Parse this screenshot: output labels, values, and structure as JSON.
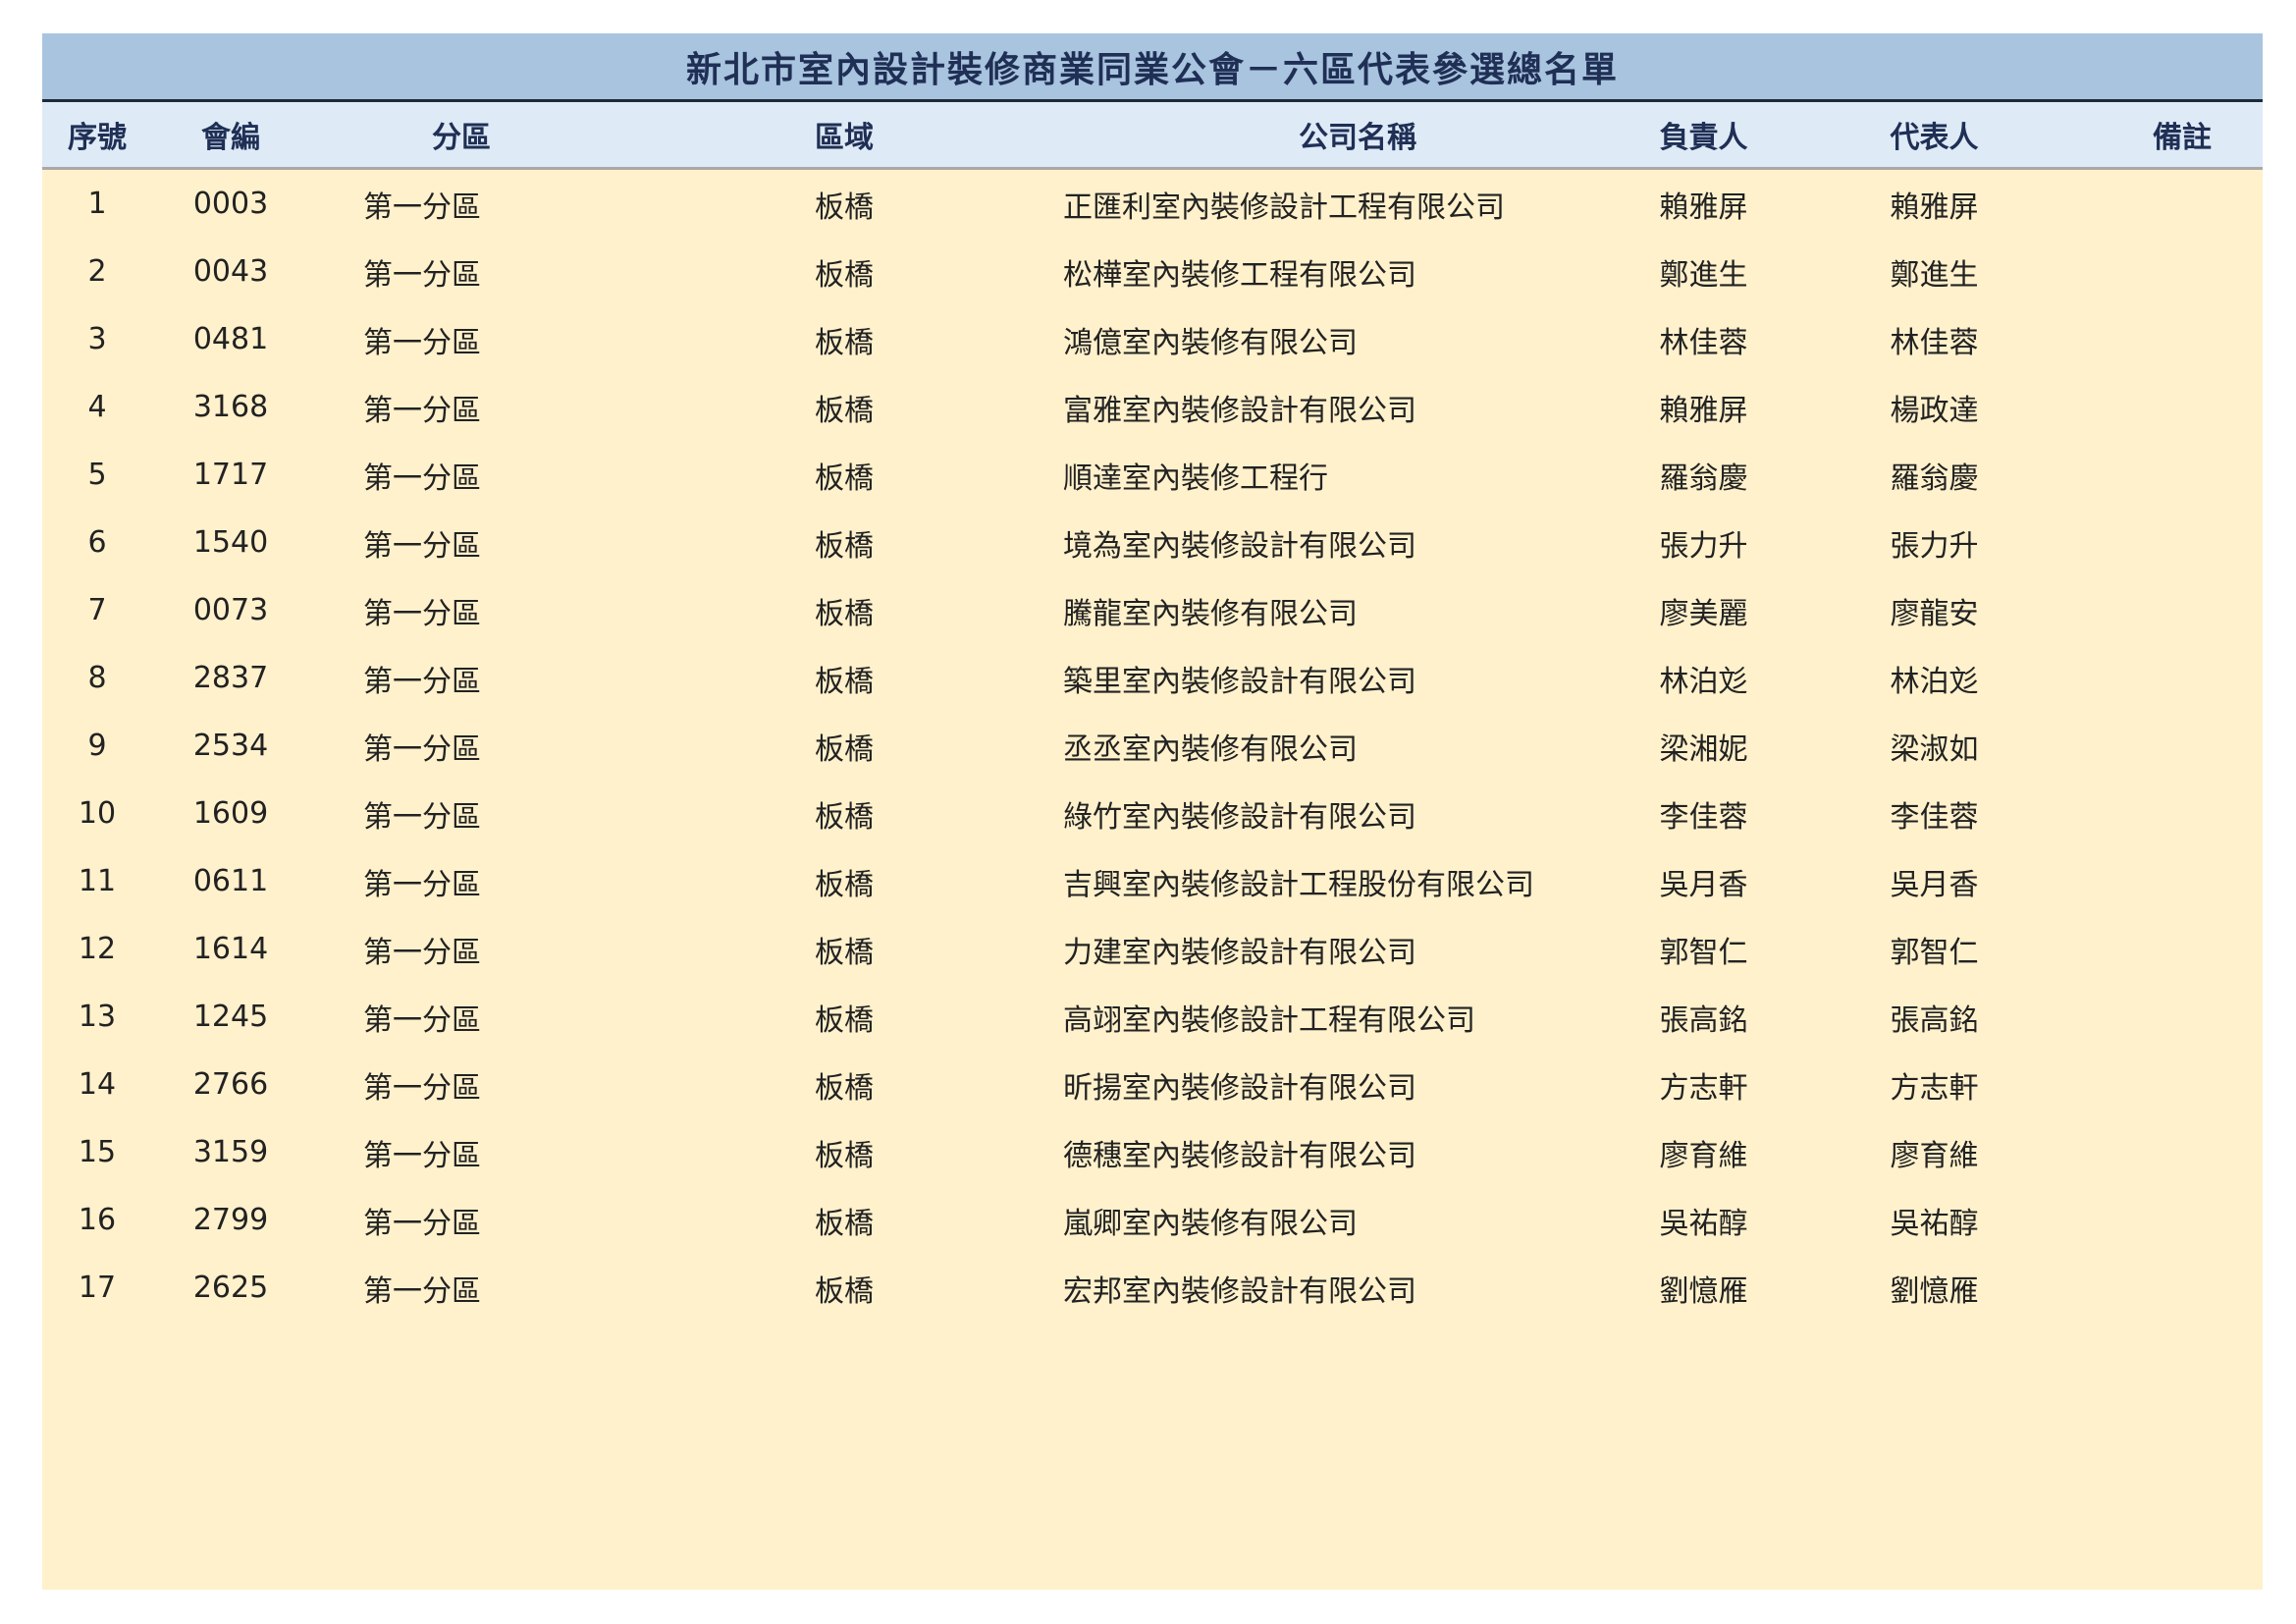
{
  "title": "新北市室內設計裝修商業同業公會－六區代表參選總名單",
  "headers": {
    "no": "序號",
    "member_code": "會編",
    "division": "分區",
    "area": "區域",
    "company": "公司名稱",
    "responsible": "負責人",
    "representative": "代表人",
    "note": "備註"
  },
  "rows": [
    {
      "no": "1",
      "code": "0003",
      "division": "第一分區",
      "area": "板橋",
      "company": "正匯利室內裝修設計工程有限公司",
      "responsible": "賴雅屏",
      "representative": "賴雅屏",
      "note": ""
    },
    {
      "no": "2",
      "code": "0043",
      "division": "第一分區",
      "area": "板橋",
      "company": "松樺室內裝修工程有限公司",
      "responsible": "鄭進生",
      "representative": "鄭進生",
      "note": ""
    },
    {
      "no": "3",
      "code": "0481",
      "division": "第一分區",
      "area": "板橋",
      "company": "鴻億室內裝修有限公司",
      "responsible": "林佳蓉",
      "representative": "林佳蓉",
      "note": ""
    },
    {
      "no": "4",
      "code": "3168",
      "division": "第一分區",
      "area": "板橋",
      "company": "富雅室內裝修設計有限公司",
      "responsible": "賴雅屏",
      "representative": "楊政達",
      "note": ""
    },
    {
      "no": "5",
      "code": "1717",
      "division": "第一分區",
      "area": "板橋",
      "company": "順達室內裝修工程行",
      "responsible": "羅翁慶",
      "representative": "羅翁慶",
      "note": ""
    },
    {
      "no": "6",
      "code": "1540",
      "division": "第一分區",
      "area": "板橋",
      "company": "境為室內裝修設計有限公司",
      "responsible": "張力升",
      "representative": "張力升",
      "note": ""
    },
    {
      "no": "7",
      "code": "0073",
      "division": "第一分區",
      "area": "板橋",
      "company": "騰龍室內裝修有限公司",
      "responsible": "廖美麗",
      "representative": "廖龍安",
      "note": ""
    },
    {
      "no": "8",
      "code": "2837",
      "division": "第一分區",
      "area": "板橋",
      "company": "築里室內裝修設計有限公司",
      "responsible": "林泊彣",
      "representative": "林泊彣",
      "note": ""
    },
    {
      "no": "9",
      "code": "2534",
      "division": "第一分區",
      "area": "板橋",
      "company": "丞丞室內裝修有限公司",
      "responsible": "梁湘妮",
      "representative": "梁淑如",
      "note": ""
    },
    {
      "no": "10",
      "code": "1609",
      "division": "第一分區",
      "area": "板橋",
      "company": "綠竹室內裝修設計有限公司",
      "responsible": "李佳蓉",
      "representative": "李佳蓉",
      "note": ""
    },
    {
      "no": "11",
      "code": "0611",
      "division": "第一分區",
      "area": "板橋",
      "company": "吉興室內裝修設計工程股份有限公司",
      "responsible": "吳月香",
      "representative": "吳月香",
      "note": ""
    },
    {
      "no": "12",
      "code": "1614",
      "division": "第一分區",
      "area": "板橋",
      "company": "力建室內裝修設計有限公司",
      "responsible": "郭智仁",
      "representative": "郭智仁",
      "note": ""
    },
    {
      "no": "13",
      "code": "1245",
      "division": "第一分區",
      "area": "板橋",
      "company": "高翊室內裝修設計工程有限公司",
      "responsible": "張高銘",
      "representative": "張高銘",
      "note": ""
    },
    {
      "no": "14",
      "code": "2766",
      "division": "第一分區",
      "area": "板橋",
      "company": "昕揚室內裝修設計有限公司",
      "responsible": "方志軒",
      "representative": "方志軒",
      "note": ""
    },
    {
      "no": "15",
      "code": "3159",
      "division": "第一分區",
      "area": "板橋",
      "company": "德穗室內裝修設計有限公司",
      "responsible": "廖育維",
      "representative": "廖育維",
      "note": ""
    },
    {
      "no": "16",
      "code": "2799",
      "division": "第一分區",
      "area": "板橋",
      "company": "嵐卿室內裝修有限公司",
      "responsible": "吳祐醇",
      "representative": "吳祐醇",
      "note": ""
    },
    {
      "no": "17",
      "code": "2625",
      "division": "第一分區",
      "area": "板橋",
      "company": "宏邦室內裝修設計有限公司",
      "responsible": "劉憶雁",
      "representative": "劉憶雁",
      "note": ""
    }
  ],
  "colors": {
    "title_bg": "#a9c4de",
    "header_bg": "#deeaf6",
    "body_bg": "#fff1cc",
    "title_text": "#1f2f55"
  }
}
